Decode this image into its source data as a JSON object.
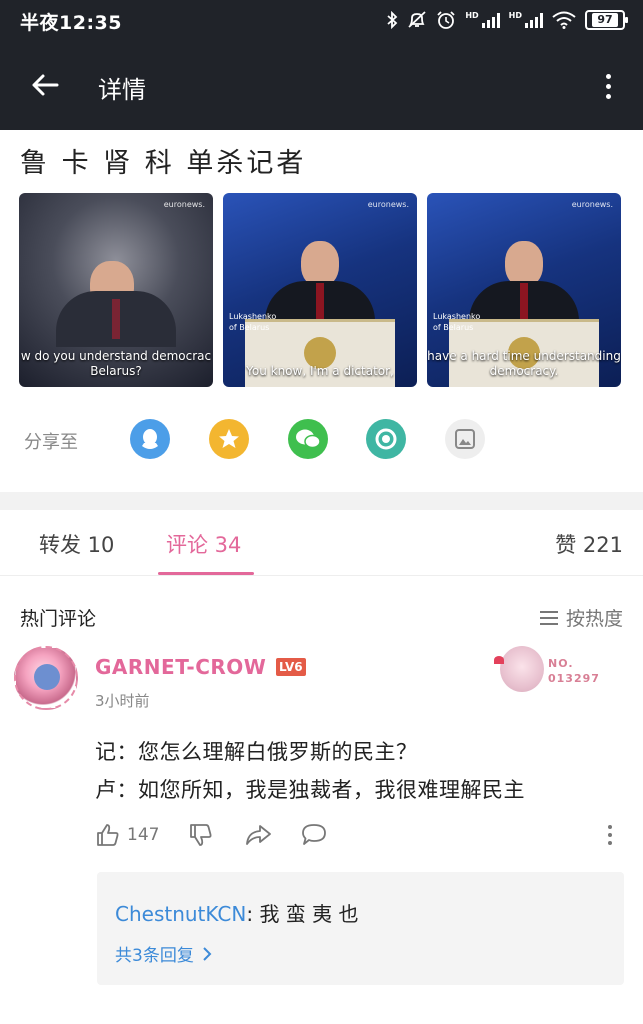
{
  "status_bar": {
    "time": "半夜12:35",
    "battery": "97",
    "network_label_1": "HD",
    "network_label_2": "HD"
  },
  "app_bar": {
    "title": "详情"
  },
  "post": {
    "title": "鲁 卡 肾 科 单杀记者",
    "images": [
      {
        "logo": "euronews.",
        "caption_1": "w do you understand democrac",
        "caption_2": "Belarus?",
        "lower_third_1": "",
        "lower_third_2": ""
      },
      {
        "logo": "euronews.",
        "caption_1": "You know, I'm a dictator,",
        "caption_2": "",
        "lower_third_1": "Lukashenko",
        "lower_third_2": "of Belarus"
      },
      {
        "logo": "euronews.",
        "caption_1": "have a hard time understanding",
        "caption_2": "democracy.",
        "lower_third_1": "Lukashenko",
        "lower_third_2": "of Belarus"
      }
    ]
  },
  "share": {
    "label": "分享至",
    "icons": [
      "qq-icon",
      "qzone-icon",
      "wechat-icon",
      "moments-icon",
      "album-icon"
    ],
    "colors": [
      "#4c9ee8",
      "#f3b630",
      "#3fbf4e",
      "#3fb6a3",
      "#eeeeee"
    ]
  },
  "tabs": {
    "repost": "转发 10",
    "comments": "评论 34",
    "likes": "赞 221",
    "accent": "#e3689a"
  },
  "comments_section": {
    "heading": "热门评论",
    "sort_label": "按热度"
  },
  "comment": {
    "username": "GARNET-CROW",
    "level": "LV6",
    "time": "3小时前",
    "medal_no_1": "NO.",
    "medal_no_2": "013297",
    "line_1": "记：您怎么理解白俄罗斯的民主？",
    "line_2": "卢：如您所知，我是独裁者，我很难理解民主",
    "like_count": "147",
    "reply": {
      "user": "ChestnutKCN",
      "text": ": 我 蛮 夷 也",
      "more": "共3条回复"
    }
  }
}
